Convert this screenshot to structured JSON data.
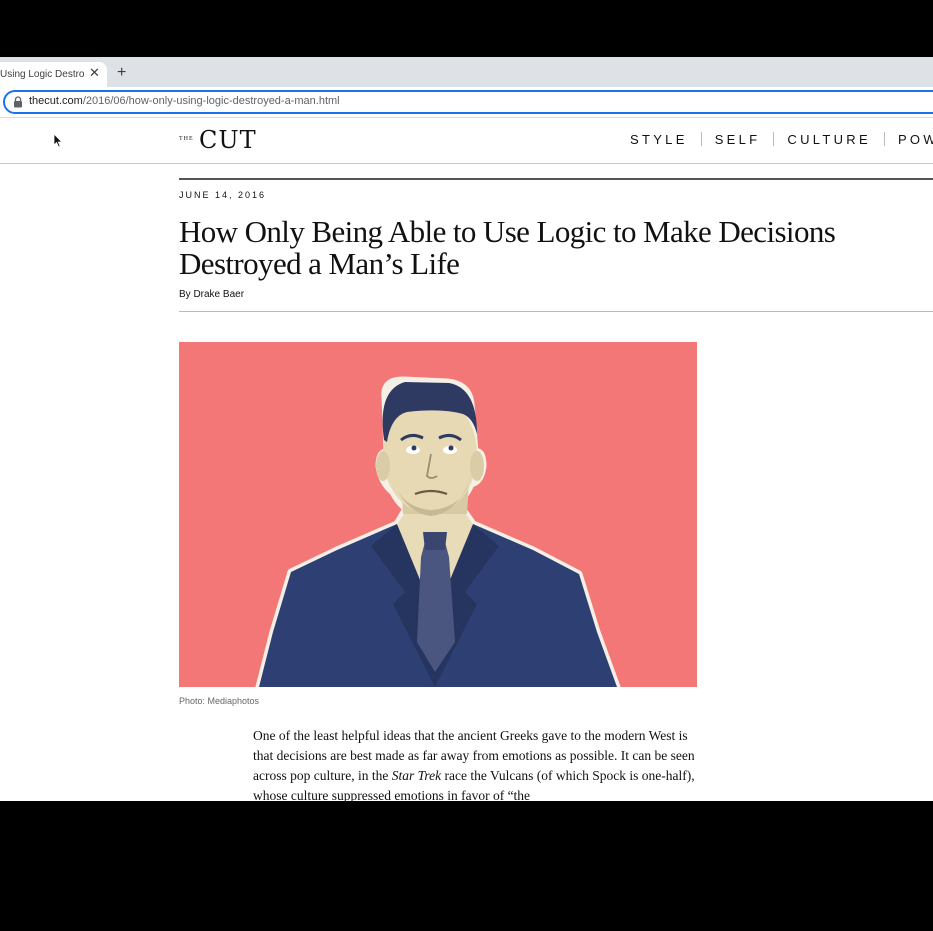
{
  "browser": {
    "tab_title": "Using Logic Destroy",
    "tab_close": "✕",
    "new_tab": "+",
    "url_host": "thecut.com",
    "url_path": "/2016/06/how-only-using-logic-destroyed-a-man.html"
  },
  "site": {
    "logo_the": "THE",
    "logo_cut": "CUT",
    "nav": [
      "STYLE",
      "SELF",
      "CULTURE",
      "POW"
    ]
  },
  "article": {
    "date": "JUNE 14, 2016",
    "headline": "How Only Being Able to Use Logic to Make Decisions Destroyed a Man’s Life",
    "byline": "By Drake Baer",
    "photo_caption": "Photo: Mediaphotos",
    "body_part1": "One of the least helpful ideas that the ancient Greeks gave to the modern West is that decisions are best made as far away from emotions as possible. It can be seen across pop culture, in the ",
    "body_italic": "Star Trek",
    "body_part2": " race the Vulcans (of which Spock is one-half), whose culture suppressed emotions in favor of “the"
  },
  "colors": {
    "hero_background": "#f47778",
    "suit_blue": "#2e3f73",
    "omnibox_focus": "#1a73e8"
  }
}
